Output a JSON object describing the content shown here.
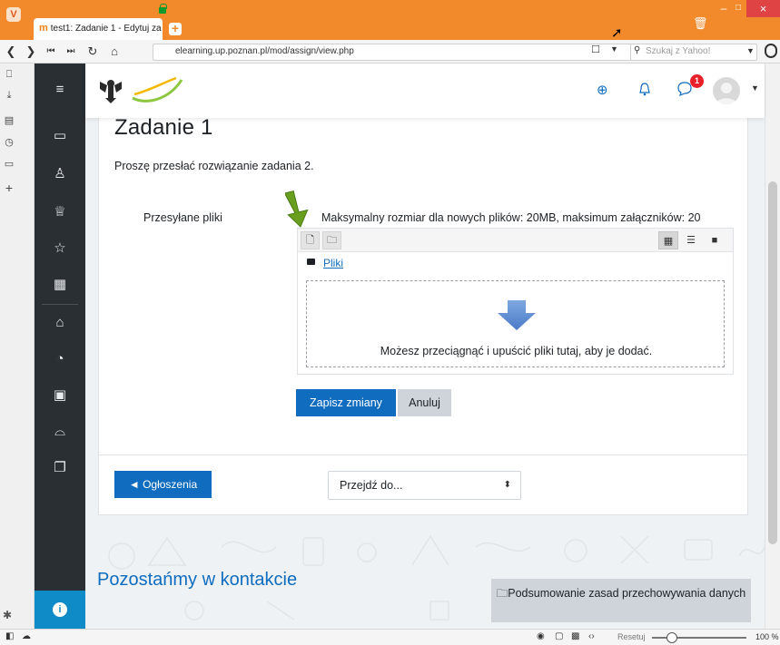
{
  "browser": {
    "tab_title": "test1: Zadanie 1 - Edytuj za",
    "url": "elearning.up.poznan.pl/mod/assign/view.php",
    "search_placeholder": "Szukaj z Yahoo!",
    "zoom_reset_label": "Resetuj",
    "zoom_level": "100 %"
  },
  "header": {
    "notification_count": "1"
  },
  "main": {
    "title": "Zadanie 1",
    "description": "Proszę przesłać rozwiązanie zadania 2.",
    "files_label": "Przesyłane pliki",
    "max_size_info": "Maksymalny rozmiar dla nowych plików: 20MB, maksimum załączników: 20",
    "filemanager": {
      "path_link": "Pliki",
      "drop_text": "Możesz przeciągnąć i upuścić pliki tutaj, aby je dodać."
    },
    "save_label": "Zapisz zmiany",
    "cancel_label": "Anuluj",
    "prev_activity_label": "◄ Ogłoszenia",
    "jump_select_value": "Przejdź do..."
  },
  "footer": {
    "title": "Pozostańmy w kontakcie",
    "privacy_link": "Podsumowanie zasad przechowywania danych"
  },
  "colors": {
    "titlebar": "#f28a2c",
    "primary": "#0f6cbf",
    "drawer": "#2a2f33",
    "info_button": "#0f8cc7",
    "annotation_arrow": "#6a9e1f"
  }
}
